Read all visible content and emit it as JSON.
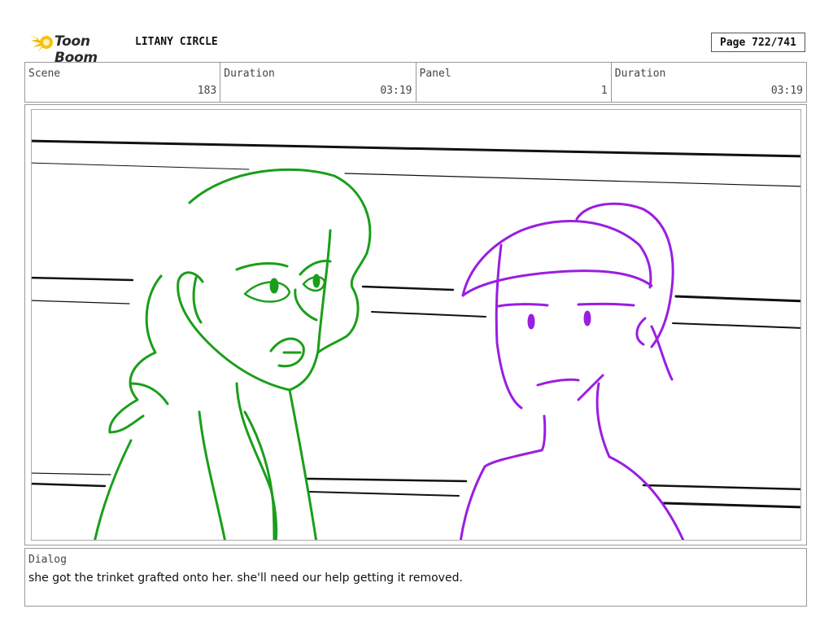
{
  "header": {
    "brand": "Toon Boom",
    "project_title": "LITANY CIRCLE",
    "page": "Page 722/741"
  },
  "info": [
    {
      "label": "Scene",
      "value": "183"
    },
    {
      "label": "Duration",
      "value": "03:19"
    },
    {
      "label": "Panel",
      "value": "1"
    },
    {
      "label": "Duration",
      "value": "03:19"
    }
  ],
  "dialog": {
    "label": "Dialog",
    "text": "she got the trinket grafted onto her. she'll need our help getting it removed."
  },
  "colors": {
    "left_character": "#1a9e1a",
    "right_character": "#9a1ee0",
    "logo_accent": "#f2b705"
  }
}
